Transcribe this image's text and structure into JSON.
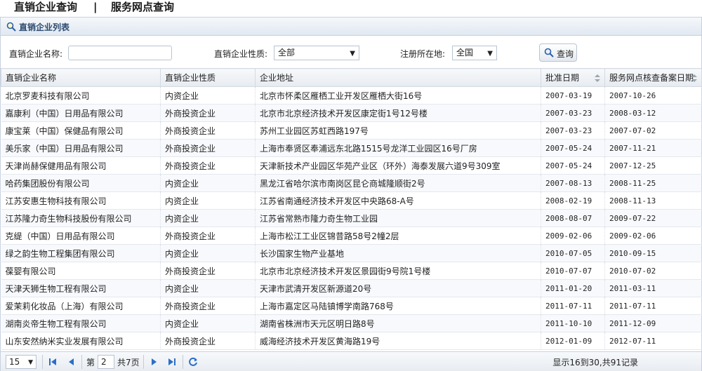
{
  "tabs": {
    "direct_sales": "直销企业查询",
    "separator": "|",
    "service_outlets": "服务网点查询"
  },
  "panel": {
    "title": "直销企业列表"
  },
  "search": {
    "name_label": "直销企业名称:",
    "name_value": "",
    "nature_label": "直销企业性质:",
    "nature_value": "全部",
    "region_label": "注册所在地:",
    "region_value": "全国",
    "query_label": "查询"
  },
  "table": {
    "headers": [
      "直销企业名称",
      "直销企业性质",
      "企业地址",
      "批准日期",
      "服务网点核查备案日期"
    ],
    "rows": [
      [
        "北京罗麦科技有限公司",
        "内资企业",
        "北京市怀柔区雁栖工业开发区雁栖大街16号",
        "2007-03-19",
        "2007-10-26"
      ],
      [
        "嘉康利（中国）日用品有限公司",
        "外商投资企业",
        "北京市北京经济技术开发区康定街1号12号楼",
        "2007-03-23",
        "2008-03-12"
      ],
      [
        "康宝莱（中国）保健品有限公司",
        "外商投资企业",
        "苏州工业园区苏虹西路197号",
        "2007-03-23",
        "2007-07-02"
      ],
      [
        "美乐家（中国）日用品有限公司",
        "外商投资企业",
        "上海市奉贤区奉浦远东北路1515号龙洋工业园区16号厂房",
        "2007-05-24",
        "2007-11-21"
      ],
      [
        "天津尚赫保健用品有限公司",
        "外商投资企业",
        "天津新技术产业园区华苑产业区（环外）海泰发展六道9号309室",
        "2007-05-24",
        "2007-12-25"
      ],
      [
        "哈药集团股份有限公司",
        "内资企业",
        "黑龙江省哈尔滨市南岗区昆仑商城隆顺街2号",
        "2007-08-13",
        "2008-11-25"
      ],
      [
        "江苏安惠生物科技有限公司",
        "内资企业",
        "江苏省南通经济技术开发区中央路68-A号",
        "2008-02-19",
        "2008-11-13"
      ],
      [
        "江苏隆力奇生物科技股份有限公司",
        "内资企业",
        "江苏省常熟市隆力奇生物工业园",
        "2008-08-07",
        "2009-07-22"
      ],
      [
        "克缇（中国）日用品有限公司",
        "外商投资企业",
        "上海市松江工业区锦昔路58号2幢2层",
        "2009-02-06",
        "2009-02-06"
      ],
      [
        "绿之韵生物工程集团有限公司",
        "内资企业",
        "长沙国家生物产业基地",
        "2010-07-05",
        "2010-09-15"
      ],
      [
        "葆婴有限公司",
        "外商投资企业",
        "北京市北京经济技术开发区景园街9号院1号楼",
        "2010-07-07",
        "2010-07-02"
      ],
      [
        "天津天狮生物工程有限公司",
        "内资企业",
        "天津市武清开发区新源道20号",
        "2011-01-20",
        "2011-03-11"
      ],
      [
        "爱茉莉化妆品（上海）有限公司",
        "外商投资企业",
        "上海市嘉定区马陆镇博学南路768号",
        "2011-07-11",
        "2011-07-11"
      ],
      [
        "湖南炎帝生物工程有限公司",
        "内资企业",
        "湖南省株洲市天元区明日路8号",
        "2011-10-10",
        "2011-12-09"
      ],
      [
        "山东安然纳米实业发展有限公司",
        "外商投资企业",
        "威海经济技术开发区黄海路19号",
        "2012-01-09",
        "2012-07-11"
      ]
    ]
  },
  "pager": {
    "page_size": "15",
    "page_prefix": "第",
    "current_page": "2",
    "page_suffix": "共7页",
    "info": "显示16到30,共91记录"
  },
  "colors": {
    "header_text": "#2b4a6f",
    "icon_blue": "#2a5fa8",
    "border": "#c7d1de"
  }
}
